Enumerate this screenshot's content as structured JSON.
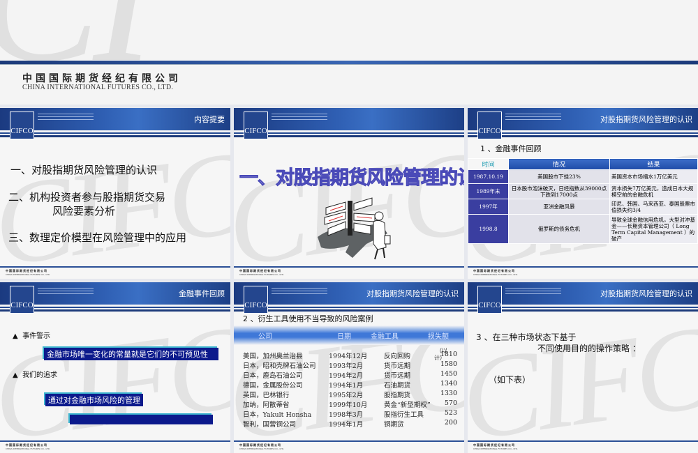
{
  "company": {
    "cn": "中国国际期货经纪有限公司",
    "en": "CHINA INTERNATIONAL FUTURES CO., LTD.",
    "logo": "CIFCO"
  },
  "colors": {
    "header": "#1b3a80",
    "accent": "#3a6fc4",
    "box": "#0c1a8c"
  },
  "slides": [
    {
      "title": "内容提要",
      "items": [
        "一、对股指期货风险管理的认识",
        "二、机构投资者参与股指期货交易",
        "风险要素分析",
        "三、数理定价模型在风险管理中的应用"
      ]
    },
    {
      "title": "",
      "headline": "一、对股指期货风险管理的认识",
      "clipart": "signpost-businessman"
    },
    {
      "title": "对股指期货风险管理的认识",
      "subtitle": "1 、金融事件回顾",
      "table": {
        "headers": [
          "时间",
          "情况",
          "结果"
        ],
        "rows": [
          [
            "1987.10.19",
            "美国股市下挫23%",
            "美国资本市场缩水1万亿美元"
          ],
          [
            "1989年末",
            "日本股市泡沫破灭，日经指数从39000点下跌到17000点",
            "资本损失7万亿美元，造成日本大规模空前的金融危机"
          ],
          [
            "1997年",
            "亚洲金融风暴",
            "印尼、韩国、马来西亚、泰国股票市值损失约3/4"
          ],
          [
            "1998.8",
            "俄罗斯的债务危机",
            "导致全球金融信用危机，大型对冲基金——长期资本管理公司（ Long Term Capital Management ）的破产"
          ]
        ]
      }
    },
    {
      "title": "金融事件回顾",
      "bullet1": "事件警示",
      "box1": "金融市场唯一变化的常量就是它们的不可预见性",
      "bullet2": "我们的追求",
      "box2": "通过对金融市场风险的管理"
    },
    {
      "title": "对股指期货风险管理的认识",
      "subtitle": "2 、衍生工具使用不当导致的风险案例",
      "table": {
        "headers": [
          "公司",
          "日期",
          "金融工具",
          "损失额"
        ],
        "unit_note_a": "（以",
        "unit_note_b": "计）",
        "rows": [
          [
            "美国，加州奥兰治县",
            "1994年12月",
            "反向回购",
            "1810"
          ],
          [
            "日本，昭和壳牌石油公司",
            "1993年2月",
            "货币远期",
            "1580"
          ],
          [
            "日本，鹿岛石油公司",
            "1994年2月",
            "货币远期",
            "1450"
          ],
          [
            "德国，金属股份公司",
            "1994年1月",
            "石油期货",
            "1340"
          ],
          [
            "英国，巴林银行",
            "1995年2月",
            "股指期货",
            "1330"
          ],
          [
            "加纳，阿散蒂省",
            "1999年10月",
            "黄金“新型期权”",
            "570"
          ],
          [
            "日本，Yakult Honsha",
            "1998年3月",
            "股指衍生工具",
            "523"
          ],
          [
            "智利，国营铜公司",
            "1994年1月",
            "铜期货",
            "200"
          ]
        ]
      }
    },
    {
      "title": "对股指期货风险管理的认识",
      "line1": "3 、在三种市场状态下基于",
      "line2": "不同使用目的的操作策略 ：",
      "line3": "（如下表）"
    }
  ]
}
